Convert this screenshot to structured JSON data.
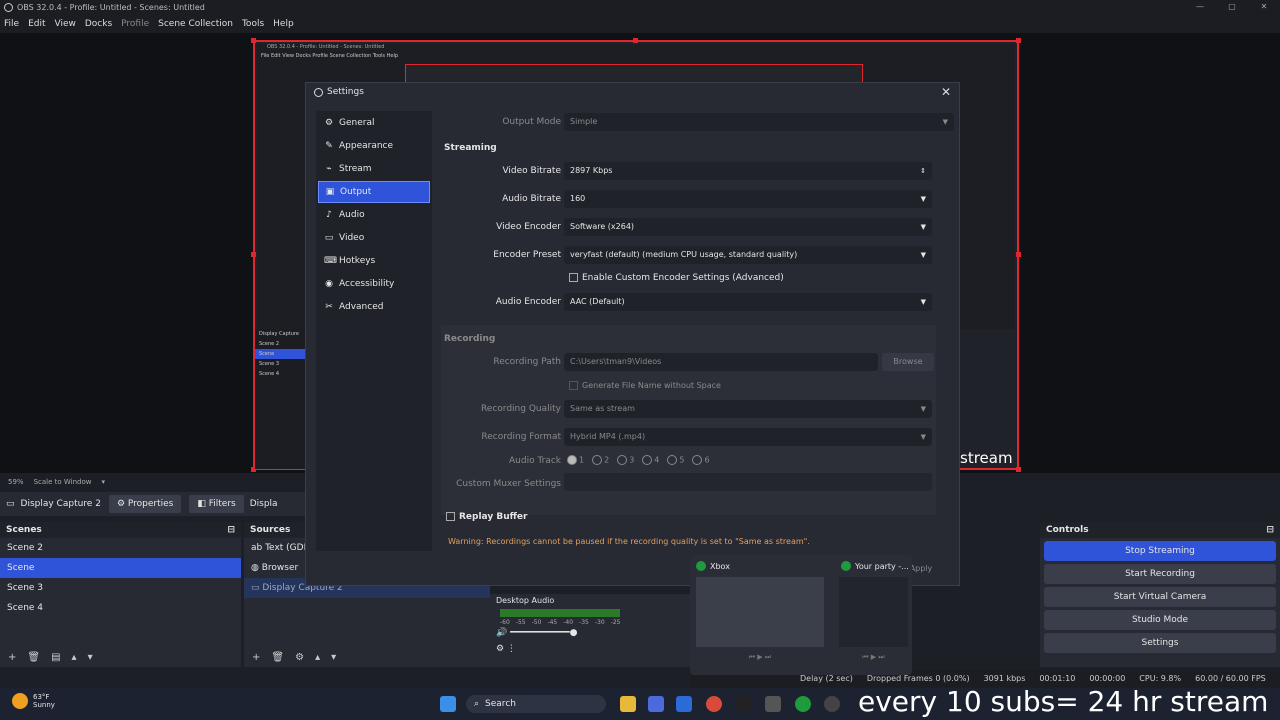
{
  "window": {
    "title": "OBS 32.0.4 - Profile: Untitled - Scenes: Untitled",
    "controls": [
      "—",
      "▢",
      "✕"
    ]
  },
  "menu": [
    "File",
    "Edit",
    "View",
    "Docks",
    "Profile",
    "Scene Collection",
    "Tools",
    "Help"
  ],
  "preview": {
    "mini_menu": "File  Edit  View  Docks  Profile  Scene Collection  Tools  Help",
    "mini_scenes": [
      "Scene 2",
      "Scene",
      "Scene 3",
      "Scene 4"
    ],
    "mini_display": "Display Capture",
    "stream_text": "stream",
    "zoom": "59%",
    "scale_mode": "Scale to Window"
  },
  "source_toolbar": {
    "source": "Display Capture 2",
    "properties": "Properties",
    "filters": "Filters",
    "more": "Displa"
  },
  "scenes": {
    "header": "Scenes",
    "items": [
      "Scene 2",
      "Scene",
      "Scene 3",
      "Scene 4"
    ],
    "selected": 1
  },
  "sources": {
    "header": "Sources",
    "items": [
      "Text (GDI+",
      "Browser",
      "Display Capture 2"
    ]
  },
  "audio": {
    "label": "Desktop Audio",
    "ticks": [
      "-60",
      "-55",
      "-50",
      "-45",
      "-40",
      "-35",
      "-30",
      "-25"
    ]
  },
  "controls": {
    "header": "Controls",
    "buttons": [
      "Stop Streaming",
      "Start Recording",
      "Start Virtual Camera",
      "Studio Mode",
      "Settings"
    ]
  },
  "status": {
    "delay": "Delay (2 sec)",
    "dropped": "Dropped Frames 0 (0.0%)",
    "bitrate": "3091 kbps",
    "stream_time": "00:01:10",
    "rec_time": "00:00:00",
    "cpu": "CPU: 9.8%",
    "fps": "60.00 / 60.00 FPS"
  },
  "taskbar": {
    "weather_temp": "63°F",
    "weather_desc": "Sunny",
    "search": "Search",
    "overlay": "every 10 subs= 24 hr stream"
  },
  "thumbnails": [
    {
      "title": "Xbox"
    },
    {
      "title": "Your party -..."
    }
  ],
  "settings": {
    "title": "Settings",
    "nav": [
      "General",
      "Appearance",
      "Stream",
      "Output",
      "Audio",
      "Video",
      "Hotkeys",
      "Accessibility",
      "Advanced"
    ],
    "nav_icons": [
      "⚙",
      "✎",
      "⌁",
      "▣",
      "♪",
      "▭",
      "⌨",
      "◉",
      "✂"
    ],
    "selected_nav": 3,
    "output_mode_label": "Output Mode",
    "output_mode": "Simple",
    "streaming": {
      "header": "Streaming",
      "video_bitrate_label": "Video Bitrate",
      "video_bitrate": "2897 Kbps",
      "audio_bitrate_label": "Audio Bitrate",
      "audio_bitrate": "160",
      "video_encoder_label": "Video Encoder",
      "video_encoder": "Software (x264)",
      "encoder_preset_label": "Encoder Preset",
      "encoder_preset": "veryfast (default) (medium CPU usage, standard quality)",
      "custom_encoder": "Enable Custom Encoder Settings (Advanced)",
      "audio_encoder_label": "Audio Encoder",
      "audio_encoder": "AAC (Default)"
    },
    "recording": {
      "header": "Recording",
      "path_label": "Recording Path",
      "path": "C:\\Users\\tman9\\Videos",
      "browse": "Browse",
      "no_space": "Generate File Name without Space",
      "quality_label": "Recording Quality",
      "quality": "Same as stream",
      "format_label": "Recording Format",
      "format": "Hybrid MP4 (.mp4)",
      "track_label": "Audio Track",
      "tracks": [
        "1",
        "2",
        "3",
        "4",
        "5",
        "6"
      ],
      "muxer_label": "Custom Muxer Settings"
    },
    "replay_buffer": "Replay Buffer",
    "warning": "Warning: Recordings cannot be paused if the recording quality is set to \"Same as stream\".",
    "apply": "Apply"
  }
}
